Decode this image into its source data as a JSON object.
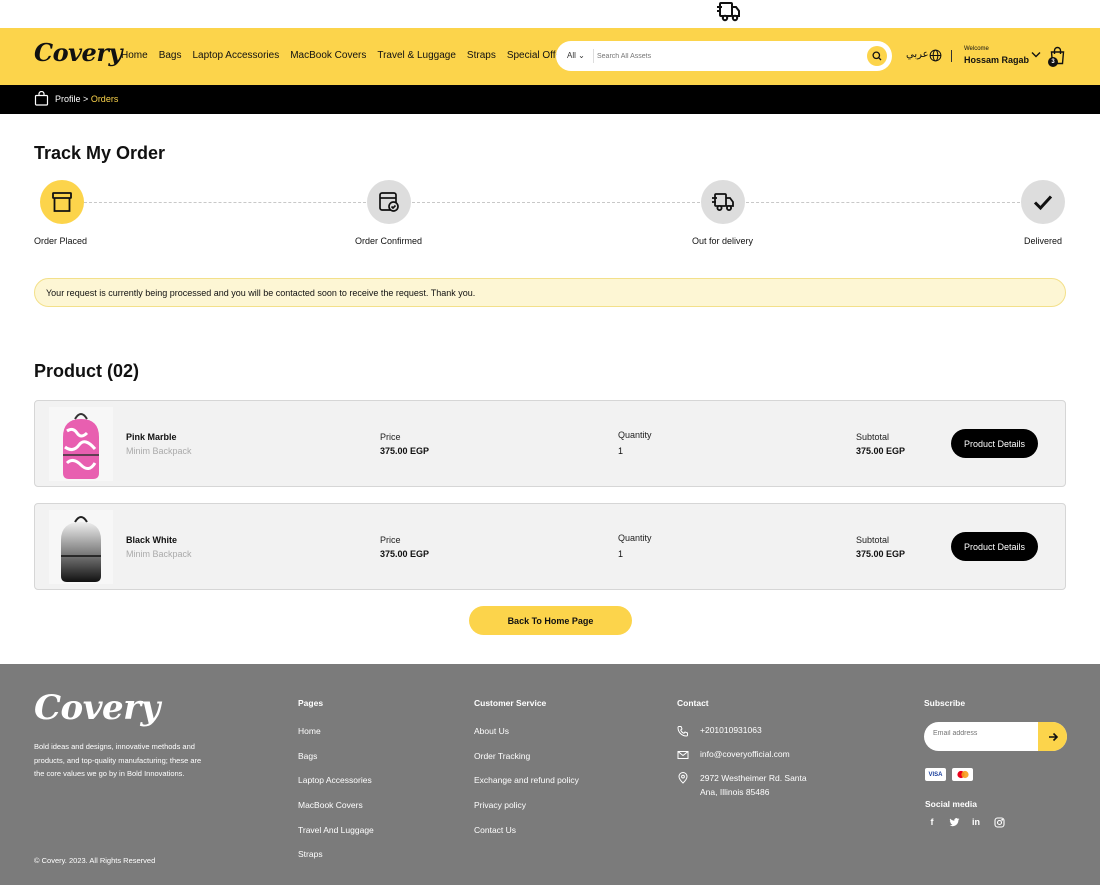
{
  "top_icon": "delivery-truck-icon",
  "header": {
    "logo": "Covery",
    "nav": [
      "Home",
      "Bags",
      "Laptop Accessories",
      "MacBook Covers",
      "Travel & Luggage",
      "Straps",
      "Special Offer!"
    ],
    "search": {
      "category": "All",
      "placeholder": "Search All Assets"
    },
    "language": "عربي",
    "welcome": "Welcome",
    "user": "Hossam Ragab",
    "cart_count": "3"
  },
  "breadcrumb": {
    "parent": "Profile",
    "separator": ">",
    "current": "Orders"
  },
  "track": {
    "title": "Track My Order",
    "steps": [
      {
        "label": "Order Placed",
        "icon": "box-icon",
        "active": true
      },
      {
        "label": "Order Confirmed",
        "icon": "calendar-check-icon",
        "active": false
      },
      {
        "label": "Out for delivery",
        "icon": "delivery-truck-icon",
        "active": false
      },
      {
        "label": "Delivered",
        "icon": "checkmark-icon",
        "active": false
      }
    ],
    "notice": "Your request is currently being processed and you will be contacted soon to receive the request. Thank you."
  },
  "products": {
    "title": "Product (02)",
    "price_label": "Price",
    "quantity_label": "Quantity",
    "subtotal_label": "Subtotal",
    "button_label": "Product Details",
    "items": [
      {
        "name": "Pink Marble",
        "type": "Minim Backpack",
        "price": "375.00 EGP",
        "quantity": "1",
        "subtotal": "375.00 EGP",
        "color": "#e85fb0"
      },
      {
        "name": "Black White",
        "type": "Minim Backpack",
        "price": "375.00 EGP",
        "quantity": "1",
        "subtotal": "375.00 EGP",
        "color": "#2a2a2a"
      }
    ]
  },
  "back_button": "Back To Home Page",
  "footer": {
    "logo": "Covery",
    "tagline": "Bold ideas and designs, innovative methods and products, and top-quality manufacturing; these are the core values we go by in Bold Innovations.",
    "copyright": "© Covery. 2023. All Rights Reserved",
    "pages_title": "Pages",
    "pages": [
      "Home",
      "Bags",
      "Laptop Accessories",
      "MacBook Covers",
      "Travel And Luggage",
      "Straps"
    ],
    "service_title": "Customer Service",
    "service": [
      "About Us",
      "Order Tracking",
      "Exchange and refund policy",
      "Privacy policy",
      "Contact Us"
    ],
    "contact_title": "Contact",
    "phone": "+201010931063",
    "email": "info@coveryofficial.com",
    "address_line1": "2972 Westheimer Rd. Santa",
    "address_line2": "Ana, Illinois 85486",
    "subscribe_title": "Subscribe",
    "email_placeholder": "Email address",
    "payment": [
      "VISA",
      "mastercard"
    ],
    "social_title": "Social media",
    "social": [
      "facebook-icon",
      "twitter-icon",
      "linkedin-icon",
      "instagram-icon"
    ]
  },
  "colors": {
    "brand_yellow": "#fcd44b",
    "footer_gray": "#7b7b7b",
    "black": "#000000"
  }
}
